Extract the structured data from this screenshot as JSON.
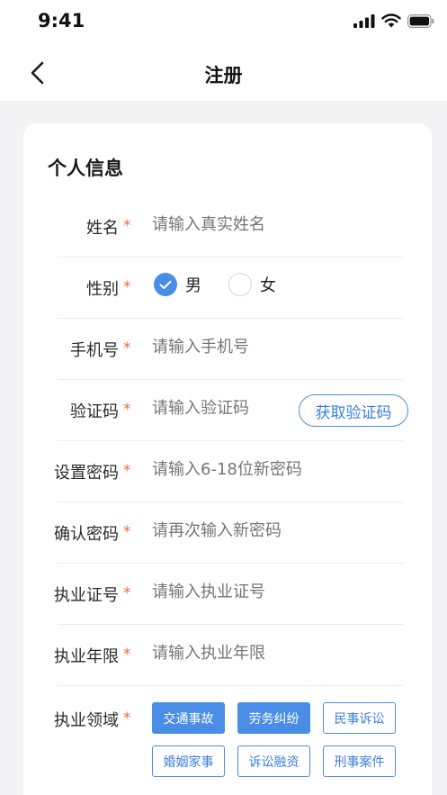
{
  "status_bar": {
    "time": "9:41"
  },
  "nav": {
    "title": "注册"
  },
  "form": {
    "section_title": "个人信息",
    "required_mark": "*",
    "name": {
      "label": "姓名",
      "placeholder": "请输入真实姓名"
    },
    "gender": {
      "label": "性别",
      "options": [
        "男",
        "女"
      ],
      "selected": "男"
    },
    "phone": {
      "label": "手机号",
      "placeholder": "请输入手机号"
    },
    "code": {
      "label": "验证码",
      "placeholder": "请输入验证码",
      "button": "获取验证码"
    },
    "password": {
      "label": "设置密码",
      "placeholder": "请输入6-18位新密码"
    },
    "confirm_password": {
      "label": "确认密码",
      "placeholder": "请再次输入新密码"
    },
    "license_no": {
      "label": "执业证号",
      "placeholder": "请输入执业证号"
    },
    "license_years": {
      "label": "执业年限",
      "placeholder": "请输入执业年限"
    },
    "practice_area": {
      "label": "执业领域",
      "tags": [
        "交通事故",
        "劳务纠纷",
        "民事诉讼",
        "婚姻家事",
        "诉讼融资",
        "刑事案件"
      ],
      "selected": [
        "交通事故",
        "劳务纠纷"
      ]
    }
  },
  "colors": {
    "accent": "#4a8de6",
    "required": "#f26b3a",
    "placeholder": "#a8a8a8"
  }
}
